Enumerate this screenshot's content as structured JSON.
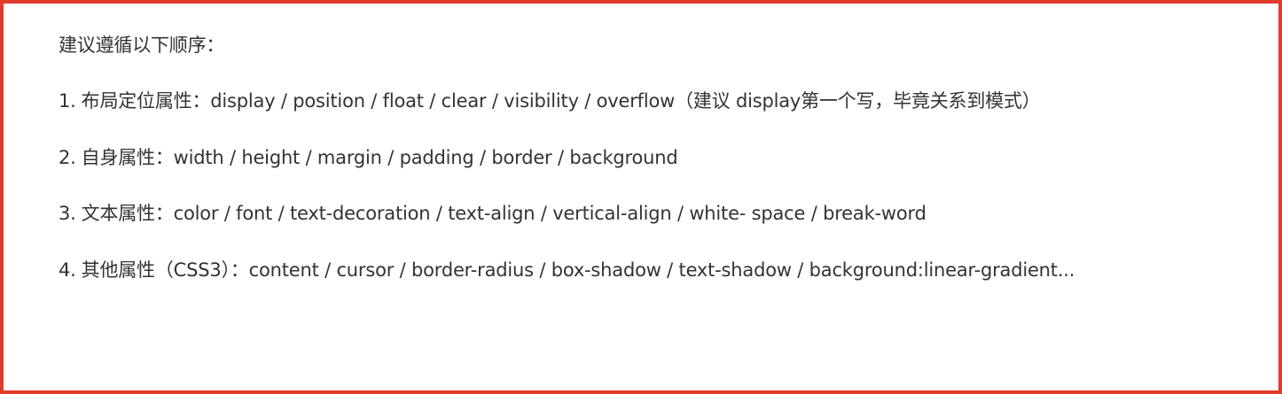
{
  "frame": {
    "border_color": "#e23a2a",
    "text_color": "#333333"
  },
  "intro": "建议遵循以下顺序：",
  "items": [
    {
      "number": "1.",
      "label": "布局定位属性：",
      "text": "display / position / float / clear / visibility / overflow（建议 display第一个写，毕竟关系到模式）"
    },
    {
      "number": "2.",
      "label": "自身属性：",
      "text": "width / height / margin / padding / border / background"
    },
    {
      "number": "3.",
      "label": "文本属性：",
      "text": "color / font / text-decoration / text-align / vertical-align / white- space / break-word"
    },
    {
      "number": "4.",
      "label": "其他属性（CSS3）：",
      "text": "content / cursor / border-radius / box-shadow / text-shadow / background:linear-gradient..."
    }
  ]
}
